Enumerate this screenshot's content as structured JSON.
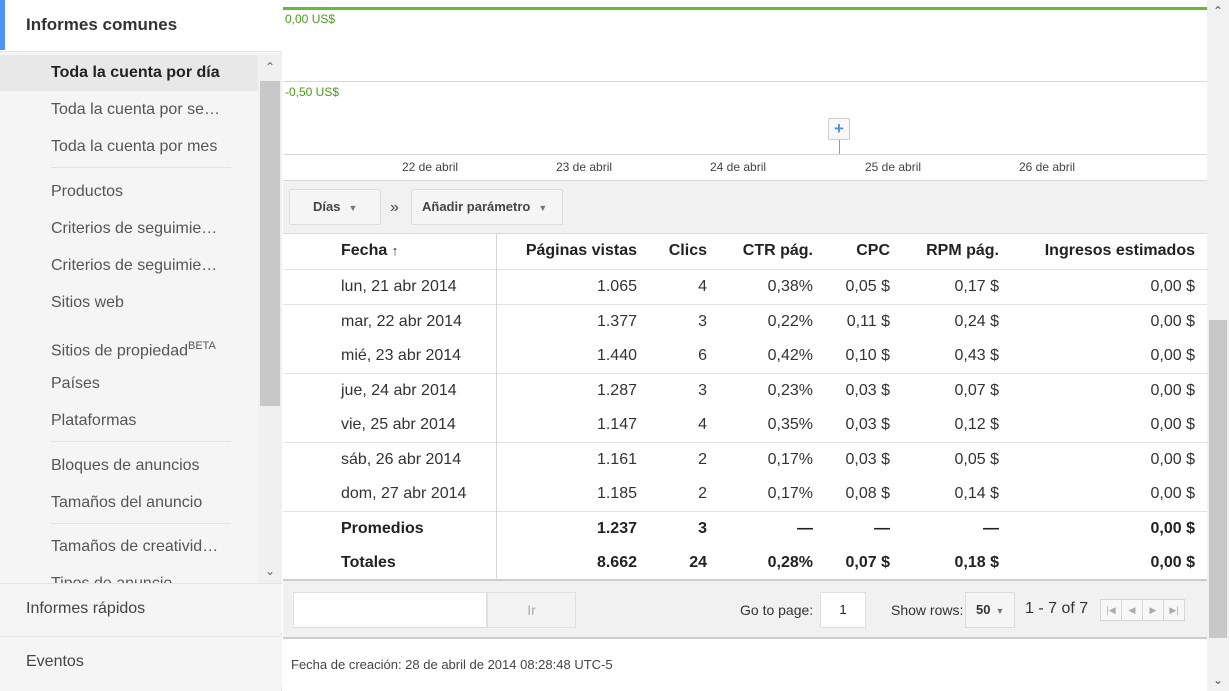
{
  "sidebar": {
    "section_title": "Informes comunes",
    "items": [
      {
        "label": "Toda la cuenta por día"
      },
      {
        "label": "Toda la cuenta por se…"
      },
      {
        "label": "Toda la cuenta por mes"
      },
      {
        "label": "Productos"
      },
      {
        "label": "Criterios de seguimie…"
      },
      {
        "label": "Criterios de seguimie…"
      },
      {
        "label": "Sitios web"
      },
      {
        "label": "Sitios de propiedad",
        "badge": "BETA"
      },
      {
        "label": "Países"
      },
      {
        "label": "Plataformas"
      },
      {
        "label": "Bloques de anuncios"
      },
      {
        "label": "Tamaños del anuncio"
      },
      {
        "label": "Tamaños de creativid…"
      },
      {
        "label": "Tipos de anuncio"
      }
    ],
    "bottom_items": [
      {
        "label": "Informes rápidos"
      },
      {
        "label": "Eventos"
      }
    ]
  },
  "chart": {
    "y_labels": [
      "0,00 US$",
      "-0,50 US$"
    ],
    "x_ticks": [
      "22 de abril",
      "23 de abril",
      "24 de abril",
      "25 de abril",
      "26 de abril"
    ],
    "marker_symbol": "+",
    "line_color": "#66bb33"
  },
  "chart_data": {
    "type": "line",
    "x": [
      "21 de abril",
      "22 de abril",
      "23 de abril",
      "24 de abril",
      "25 de abril",
      "26 de abril",
      "27 de abril"
    ],
    "series": [
      {
        "values": [
          0,
          0,
          0,
          0,
          0,
          0,
          0
        ]
      }
    ],
    "y_tick_labels": [
      "0,00 US$",
      "-0,50 US$"
    ],
    "x_tick_labels": [
      "22 de abril",
      "23 de abril",
      "24 de abril",
      "25 de abril",
      "26 de abril"
    ],
    "grid": true
  },
  "toolbar": {
    "dimension_label": "Días",
    "separator": "»",
    "add_param_label": "Añadir parámetro"
  },
  "table": {
    "headers": [
      "Fecha",
      "Páginas vistas",
      "Clics",
      "CTR pág.",
      "CPC",
      "RPM pág.",
      "Ingresos estimados"
    ],
    "sort_indicator": "↑",
    "rows": [
      [
        "lun, 21 abr 2014",
        "1.065",
        "4",
        "0,38%",
        "0,05 $",
        "0,17 $",
        "0,00 $"
      ],
      [
        "mar, 22 abr 2014",
        "1.377",
        "3",
        "0,22%",
        "0,11 $",
        "0,24 $",
        "0,00 $"
      ],
      [
        "mié, 23 abr 2014",
        "1.440",
        "6",
        "0,42%",
        "0,10 $",
        "0,43 $",
        "0,00 $"
      ],
      [
        "jue, 24 abr 2014",
        "1.287",
        "3",
        "0,23%",
        "0,03 $",
        "0,07 $",
        "0,00 $"
      ],
      [
        "vie, 25 abr 2014",
        "1.147",
        "4",
        "0,35%",
        "0,03 $",
        "0,12 $",
        "0,00 $"
      ],
      [
        "sáb, 26 abr 2014",
        "1.161",
        "2",
        "0,17%",
        "0,03 $",
        "0,05 $",
        "0,00 $"
      ],
      [
        "dom, 27 abr 2014",
        "1.185",
        "2",
        "0,17%",
        "0,08 $",
        "0,14 $",
        "0,00 $"
      ]
    ],
    "averages": [
      "Promedios",
      "1.237",
      "3",
      "—",
      "—",
      "—",
      "0,00 $"
    ],
    "totals": [
      "Totales",
      "8.662",
      "24",
      "0,28%",
      "0,07 $",
      "0,18 $",
      "0,00 $"
    ]
  },
  "pager": {
    "go_button": "Ir",
    "go_to_page_label": "Go to page:",
    "page_value": "1",
    "show_rows_label": "Show rows:",
    "rows_value": "50",
    "range_text": "1 - 7 of 7",
    "nav_icons": [
      "first-page-icon",
      "prev-page-icon",
      "next-page-icon",
      "last-page-icon"
    ]
  },
  "footer": {
    "creation_text": "Fecha de creación: 28 de abril de 2014 08:28:48 UTC-5"
  }
}
